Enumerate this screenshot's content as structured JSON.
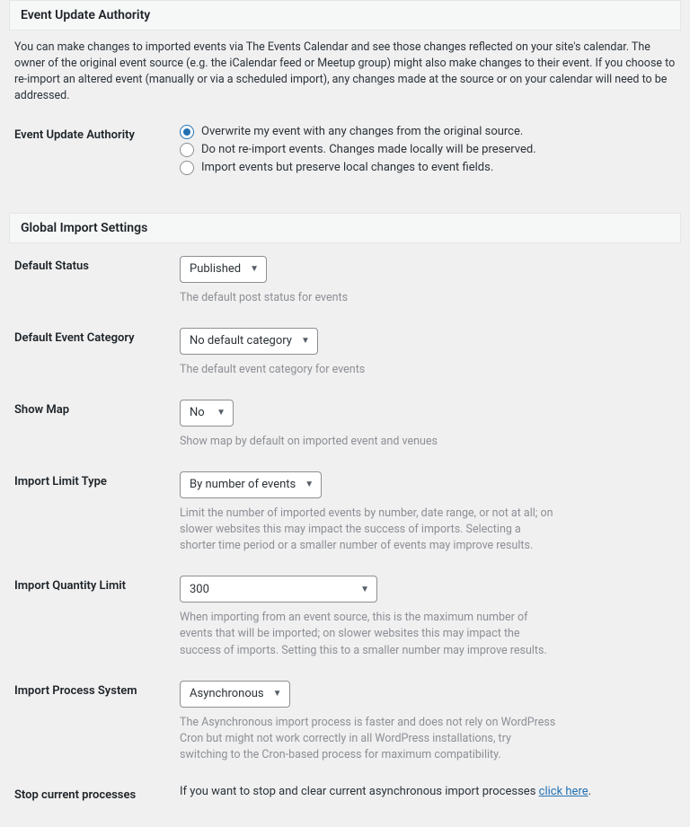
{
  "section1": {
    "title": "Event Update Authority",
    "intro": "You can make changes to imported events via The Events Calendar and see those changes reflected on your site's calendar. The owner of the original event source (e.g. the iCalendar feed or Meetup group) might also make changes to their event. If you choose to re-import an altered event (manually or via a scheduled import), any changes made at the source or on your calendar will need to be addressed.",
    "authority_label": "Event Update Authority",
    "options": {
      "o1": "Overwrite my event with any changes from the original source.",
      "o2": "Do not re-import events. Changes made locally will be preserved.",
      "o3": "Import events but preserve local changes to event fields."
    }
  },
  "section2": {
    "title": "Global Import Settings",
    "default_status": {
      "label": "Default Status",
      "value": "Published",
      "help": "The default post status for events"
    },
    "default_category": {
      "label": "Default Event Category",
      "value": "No default category",
      "help": "The default event category for events"
    },
    "show_map": {
      "label": "Show Map",
      "value": "No",
      "help": "Show map by default on imported event and venues"
    },
    "import_limit_type": {
      "label": "Import Limit Type",
      "value": "By number of events",
      "help": "Limit the number of imported events by number, date range, or not at all; on slower websites this may impact the success of imports. Selecting a shorter time period or a smaller number of events may improve results."
    },
    "import_quantity_limit": {
      "label": "Import Quantity Limit",
      "value": "300",
      "help": "When importing from an event source, this is the maximum number of events that will be imported; on slower websites this may impact the success of imports. Setting this to a smaller number may improve results."
    },
    "import_process": {
      "label": "Import Process System",
      "value": "Asynchronous",
      "help": "The Asynchronous import process is faster and does not rely on WordPress Cron but might not work correctly in all WordPress installations, try switching to the Cron-based process for maximum compatibility."
    },
    "stop_processes": {
      "label": "Stop current processes",
      "text": "If you want to stop and clear current asynchronous import processes ",
      "link": "click here",
      "after": "."
    }
  }
}
